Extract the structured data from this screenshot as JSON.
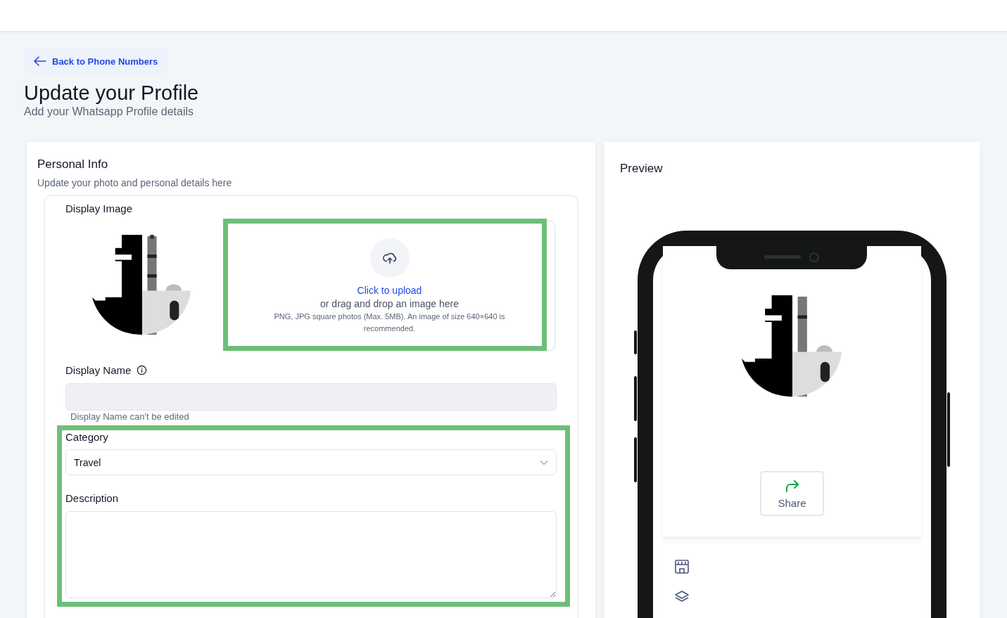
{
  "back_link": {
    "label": "Back to Phone Numbers"
  },
  "page": {
    "title": "Update your Profile",
    "subtitle": "Add your Whatsapp Profile details"
  },
  "personal_info": {
    "title": "Personal Info",
    "subtitle": "Update your photo and personal details here",
    "display_image": {
      "label": "Display Image",
      "upload": {
        "link": "Click to upload",
        "hint": "or drag and drop an image here",
        "note": "PNG, JPG square photos (Max. 5MB). An image of size 640×640 is recommended.",
        "highlighted": true
      }
    },
    "display_name": {
      "label": "Display Name",
      "helper": "Display Name can't be edited",
      "disabled": true
    },
    "details_highlighted": true,
    "category": {
      "label": "Category",
      "value": "Travel"
    },
    "description": {
      "label": "Description"
    }
  },
  "preview": {
    "title": "Preview",
    "share": {
      "label": "Share"
    }
  }
}
